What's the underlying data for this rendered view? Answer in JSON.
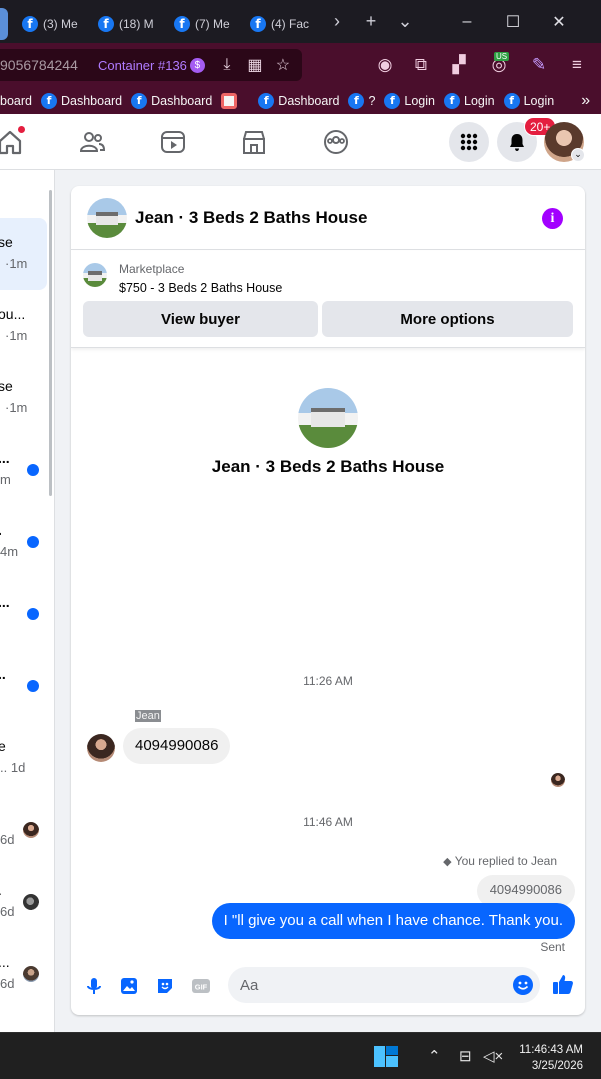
{
  "browser": {
    "tabs": [
      {
        "label": "(3) Me",
        "active": false
      },
      {
        "label": "(18) M",
        "active": false
      },
      {
        "label": "(7) Me",
        "active": true
      },
      {
        "label": "(4) Fac",
        "active": false
      }
    ],
    "url_text": "9056784244",
    "container_label": "Container #136",
    "container_badge": "$",
    "ext_badge": "US",
    "bookmarks": [
      {
        "label": "board",
        "type": "text"
      },
      {
        "label": "Dashboard",
        "type": "fb"
      },
      {
        "label": "Dashboard",
        "type": "fb"
      },
      {
        "label": "",
        "type": "square"
      },
      {
        "label": "Dashboard",
        "type": "fb"
      },
      {
        "label": "?",
        "type": "fb"
      },
      {
        "label": "Login",
        "type": "fb"
      },
      {
        "label": "Login",
        "type": "fb"
      },
      {
        "label": "Login",
        "type": "fb"
      }
    ]
  },
  "fbnav": {
    "notifications_badge": "20+"
  },
  "conversations": [
    {
      "line1": "se",
      "line2": "·1m",
      "active": true
    },
    {
      "line1": "ou...",
      "line2": "·1m"
    },
    {
      "line1": "se",
      "line2": "·1m"
    },
    {
      "line1": "...",
      "line2": "m",
      "unread": true
    },
    {
      "line1": ".",
      "line2": "4m",
      "unread": true
    },
    {
      "line1": "...",
      "line2": "",
      "unread": true
    },
    {
      "line1": "..",
      "line2": "",
      "unread": true
    },
    {
      "line1": "e",
      "line2": ".. 1d"
    },
    {
      "line1": "",
      "line2": "6d",
      "avatar": true
    },
    {
      "line1": ".",
      "line2": "6d",
      "avatar": true
    },
    {
      "line1": "...",
      "line2": "6d",
      "avatar": true
    }
  ],
  "chat": {
    "title": "Jean · 3 Beds 2 Baths House",
    "marketplace_label": "Marketplace",
    "listing": "$750 - 3 Beds 2 Baths House",
    "view_buyer_label": "View buyer",
    "more_options_label": "More options",
    "profile_name": "Jean · 3 Beds 2 Baths House",
    "timestamp1": "11:26 AM",
    "sender_name": "Jean",
    "incoming_message": "4094990086",
    "timestamp2": "11:46 AM",
    "replied_note": "You replied to Jean",
    "quoted_message": "4094990086",
    "outgoing_message": "I \"ll give you a call when I have chance. Thank you.",
    "status": "Sent",
    "input_placeholder": "Aa",
    "gif_label": "GIF"
  },
  "taskbar": {
    "time": "11:46:43 AM",
    "date": "3/25/2026"
  },
  "colors": {
    "accent": "#0866ff",
    "info": "#a200ff",
    "notify": "#e41e3f",
    "url_bar": "#4a0e2c"
  }
}
